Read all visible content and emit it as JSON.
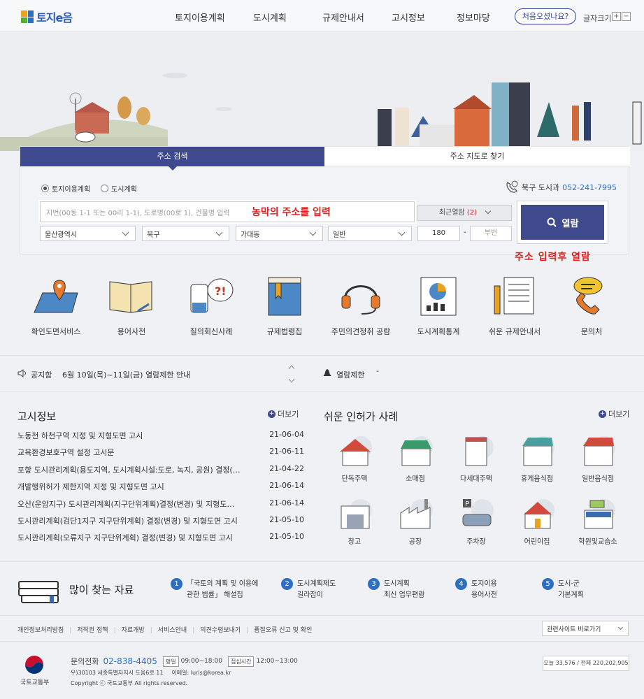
{
  "header": {
    "logo_text": "토지e음",
    "nav": [
      "토지이용계획",
      "도시계획",
      "규제안내서",
      "고시정보",
      "정보마당"
    ],
    "first_visit_button": "처음오셨나요?",
    "font_size_label": "글자크기",
    "font_plus": "+",
    "font_minus": "−"
  },
  "search": {
    "tabs": [
      "주소 검색",
      "주소 지도로 찾기"
    ],
    "radios": [
      {
        "label": "토지이용계획",
        "checked": true
      },
      {
        "label": "도시계획",
        "checked": false
      }
    ],
    "contact_label": "북구 도시과",
    "contact_phone": "052-241-7995",
    "address_placeholder": "지번(00동 1-1 또는 00리 1-1), 도로명(00로 1), 건물명 입력",
    "address_annotation": "농막의 주소를 입력",
    "recent_label": "최근열람",
    "recent_count": "(2)",
    "selects": [
      "울산광역시",
      "북구",
      "가대동",
      "일반"
    ],
    "main_number": "180",
    "dash": "-",
    "sub_number_placeholder": "부번",
    "view_button": "열람",
    "view_annotation": "주소 입력후 열람"
  },
  "services": [
    {
      "label": "확인도면서비스",
      "icon": "map-pin-icon"
    },
    {
      "label": "용어사전",
      "icon": "open-book-icon"
    },
    {
      "label": "질의회신사례",
      "icon": "question-hand-icon"
    },
    {
      "label": "규제법령집",
      "icon": "law-book-icon"
    },
    {
      "label": "주민의견청취 공람",
      "icon": "headset-icon"
    },
    {
      "label": "도시계획통계",
      "icon": "statistics-chart-icon"
    },
    {
      "label": "쉬운 규제안내서",
      "icon": "document-pencil-icon"
    },
    {
      "label": "문의처",
      "icon": "phone-chat-icon"
    }
  ],
  "notice": {
    "label": "공지함",
    "text": "6월 10일(목)~11일(금) 열람제한 안내",
    "restriction_label": "열람제한",
    "restriction_value": "-"
  },
  "gosi": {
    "title": "고시정보",
    "more": "더보기",
    "items": [
      {
        "title": "노동천 하천구역 지정 및 지형도면 고시",
        "date": "21-06-04"
      },
      {
        "title": "교육환경보호구역 설정 고시문",
        "date": "21-06-11"
      },
      {
        "title": "포항 도시관리계획(용도지역, 도시계획시설:도로, 녹지, 공원) 결정(…",
        "date": "21-04-22"
      },
      {
        "title": "개발행위허가 제한지역 지정 및 지형도면 고시",
        "date": "21-06-14"
      },
      {
        "title": "오산(운암지구) 도시관리계획(지구단위계획)결정(변경) 및 지형도…",
        "date": "21-06-14"
      },
      {
        "title": "도시관리계획(검단1지구 지구단위계획) 결정(변경) 및 지형도면 고시",
        "date": "21-05-10"
      },
      {
        "title": "도시관리계획(오류지구 지구단위계획) 결정(변경) 및 지형도면 고시",
        "date": "21-05-10"
      }
    ]
  },
  "cases": {
    "title": "쉬운 인허가 사례",
    "more": "더보기",
    "items": [
      "단독주택",
      "소매점",
      "다세대주택",
      "휴게음식점",
      "일반음식점",
      "창고",
      "공장",
      "주차장",
      "어린이집",
      "학원및교습소"
    ]
  },
  "popular": {
    "title": "많이 찾는 자료",
    "items": [
      {
        "num": "1",
        "line1": "「국토의 계획 및 이용에",
        "line2": "관한 법률」 해설집"
      },
      {
        "num": "2",
        "line1": "도시계획제도",
        "line2": "길라잡이"
      },
      {
        "num": "3",
        "line1": "도시계획",
        "line2": "최신 업무편람"
      },
      {
        "num": "4",
        "line1": "토지이용",
        "line2": "용어사전"
      },
      {
        "num": "5",
        "line1": "도시·군",
        "line2": "기본계획"
      }
    ]
  },
  "footer": {
    "links": [
      "개인정보처리방침",
      "저작권 정책",
      "자료개방",
      "서비스안내",
      "의견수렴보내기",
      "품질오류 신고 및 확인"
    ],
    "related_sites": "관련사이트 바로가기",
    "ministry": "국토교통부",
    "phone_label": "문의전화",
    "phone": "02-838-4405",
    "weekday_tag": "평일",
    "weekday_hours": "09:00~18:00",
    "lunch_tag": "점심시간",
    "lunch_hours": "12:00~13:00",
    "address": "우)30103 세종특별자치시 도움6로 11",
    "email": "이메일: luris@korea.kr",
    "copyright": "Copyright ⓒ 국토교통부 All rights reserved.",
    "visitors": "오늘 33,576 / 전체 220,202,905"
  },
  "colors": {
    "primary": "#3f4a8e",
    "accent_blue": "#2f6fc1",
    "annotation_red": "#e02020"
  }
}
